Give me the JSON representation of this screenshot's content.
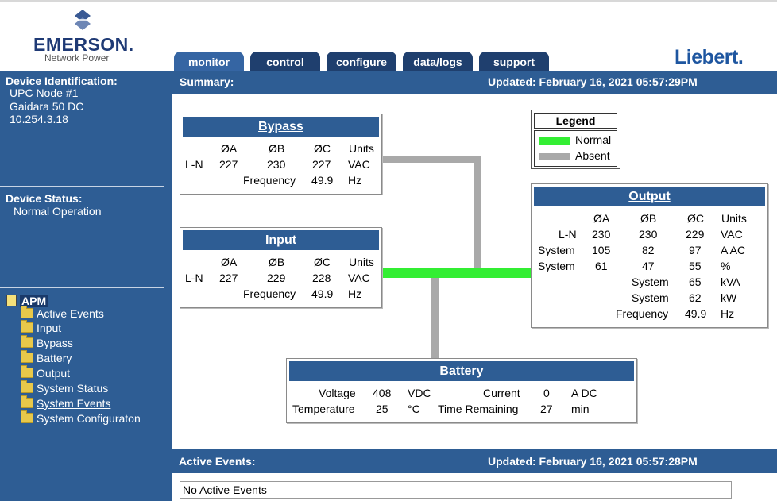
{
  "header": {
    "brand_name": "EMERSON.",
    "brand_sub": "Network Power",
    "right_logo": "Liebert.",
    "tabs": [
      "monitor",
      "control",
      "configure",
      "data/logs",
      "support"
    ]
  },
  "sidebar": {
    "device_id_heading": "Device Identification:",
    "device_id_lines": [
      "UPC Node #1",
      "Gaidara 50 DC",
      "10.254.3.18"
    ],
    "status_heading": "Device Status:",
    "status_value": "Normal Operation",
    "tree_root": "APM",
    "tree_items": [
      "Active Events",
      "Input",
      "Bypass",
      "Battery",
      "Output",
      "System Status",
      "System Events",
      "System Configuraton"
    ]
  },
  "summary": {
    "label": "Summary:",
    "updated": "Updated: February 16, 2021 05:57:29PM"
  },
  "legend": {
    "title": "Legend",
    "normal": "Normal",
    "absent": "Absent",
    "normal_color": "#33ee33",
    "absent_color": "#a9a9a9"
  },
  "bypass": {
    "title": "Bypass",
    "headers": [
      "ØA",
      "ØB",
      "ØC",
      "Units"
    ],
    "row_label": "L-N",
    "values": [
      "227",
      "230",
      "227",
      "VAC"
    ],
    "freq_label": "Frequency",
    "freq_value": "49.9",
    "freq_unit": "Hz"
  },
  "input": {
    "title": "Input",
    "headers": [
      "ØA",
      "ØB",
      "ØC",
      "Units"
    ],
    "row_label": "L-N",
    "values": [
      "227",
      "229",
      "228",
      "VAC"
    ],
    "freq_label": "Frequency",
    "freq_value": "49.9",
    "freq_unit": "Hz"
  },
  "output": {
    "title": "Output",
    "headers": [
      "ØA",
      "ØB",
      "ØC",
      "Units"
    ],
    "rows": [
      {
        "label": "L-N",
        "a": "230",
        "b": "230",
        "c": "229",
        "unit": "VAC"
      },
      {
        "label": "System",
        "a": "105",
        "b": "82",
        "c": "97",
        "unit": "A AC"
      },
      {
        "label": "System",
        "a": "61",
        "b": "47",
        "c": "55",
        "unit": "%"
      }
    ],
    "totals": [
      {
        "label": "System",
        "value": "65",
        "unit": "kVA"
      },
      {
        "label": "System",
        "value": "62",
        "unit": "kW"
      },
      {
        "label": "Frequency",
        "value": "49.9",
        "unit": "Hz"
      }
    ]
  },
  "battery": {
    "title": "Battery",
    "voltage_label": "Voltage",
    "voltage_value": "408",
    "voltage_unit": "VDC",
    "current_label": "Current",
    "current_value": "0",
    "current_unit": "A DC",
    "temp_label": "Temperature",
    "temp_value": "25",
    "temp_unit": "°C",
    "time_label": "Time Remaining",
    "time_value": "27",
    "time_unit": "min"
  },
  "events": {
    "label": "Active Events:",
    "updated": "Updated: February 16, 2021 05:57:28PM",
    "message": "No Active Events"
  }
}
